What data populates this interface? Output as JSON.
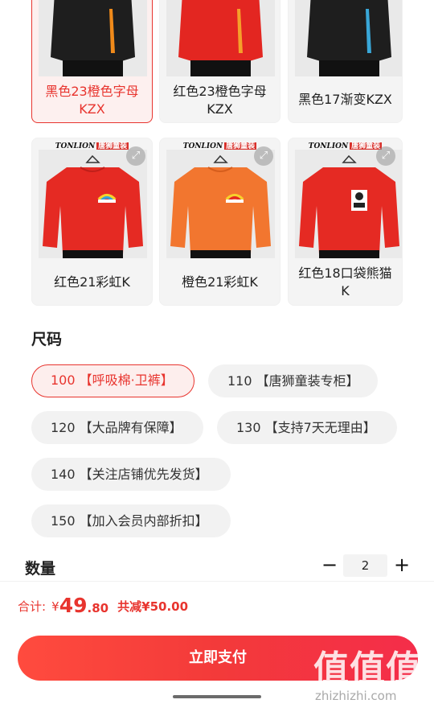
{
  "color_options": [
    {
      "label_line1": "黑色23橙色字母",
      "label_line2": "KZX",
      "selected": true
    },
    {
      "label_line1": "红色23橙色字母",
      "label_line2": "KZX",
      "selected": false
    },
    {
      "label_line1": "黑色17渐变KZX",
      "label_line2": "",
      "selected": false
    },
    {
      "label_line1": "红色21彩虹K",
      "label_line2": "",
      "selected": false
    },
    {
      "label_line1": "橙色21彩虹K",
      "label_line2": "",
      "selected": false
    },
    {
      "label_line1": "红色18口袋熊猫",
      "label_line2": "K",
      "selected": false
    }
  ],
  "brand": {
    "name": "TONLION",
    "tag": "唐狮童装"
  },
  "size_section": {
    "title": "尺码",
    "options": [
      {
        "label": "100 【呼吸棉·卫裤】",
        "selected": true
      },
      {
        "label": "110 【唐狮童装专柜】",
        "selected": false
      },
      {
        "label": "120 【大品牌有保障】",
        "selected": false
      },
      {
        "label": "130 【支持7天无理由】",
        "selected": false
      },
      {
        "label": "140 【关注店铺优先发货】",
        "selected": false
      },
      {
        "label": "150 【加入会员内部折扣】",
        "selected": false
      }
    ]
  },
  "quantity": {
    "label": "数量",
    "minus": "−",
    "value": "2",
    "plus": "+"
  },
  "footer": {
    "total_label": "合计:",
    "currency": "¥",
    "price_int": "49",
    "price_dec": ".80",
    "saved_text": "共减¥50.00",
    "pay_button": "立即支付"
  },
  "watermark": {
    "big": "值值值",
    "url": "zhizhizhi.com"
  },
  "colors": {
    "accent": "#e8342e",
    "chip_bg": "#f2f2f2",
    "tile_bg": "#f4f4f4"
  }
}
